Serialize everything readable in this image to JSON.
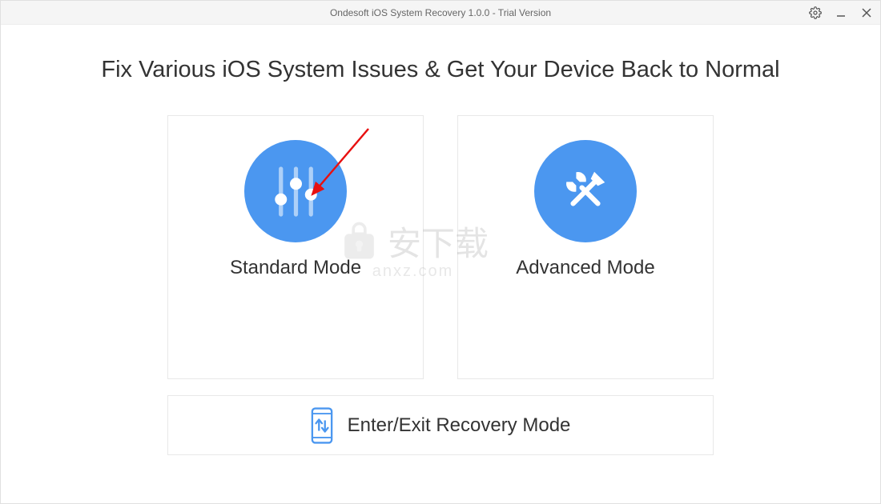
{
  "titlebar": {
    "title": "Ondesoft iOS System Recovery 1.0.0 - Trial Version"
  },
  "main": {
    "heading": "Fix Various iOS System Issues & Get Your Device Back to Normal",
    "modes": {
      "standard": {
        "label": "Standard Mode"
      },
      "advanced": {
        "label": "Advanced Mode"
      }
    },
    "recovery": {
      "label": "Enter/Exit Recovery Mode"
    }
  },
  "watermark": {
    "text": "安下载",
    "sub": "anxz.com"
  },
  "colors": {
    "accent": "#4b97f0"
  }
}
